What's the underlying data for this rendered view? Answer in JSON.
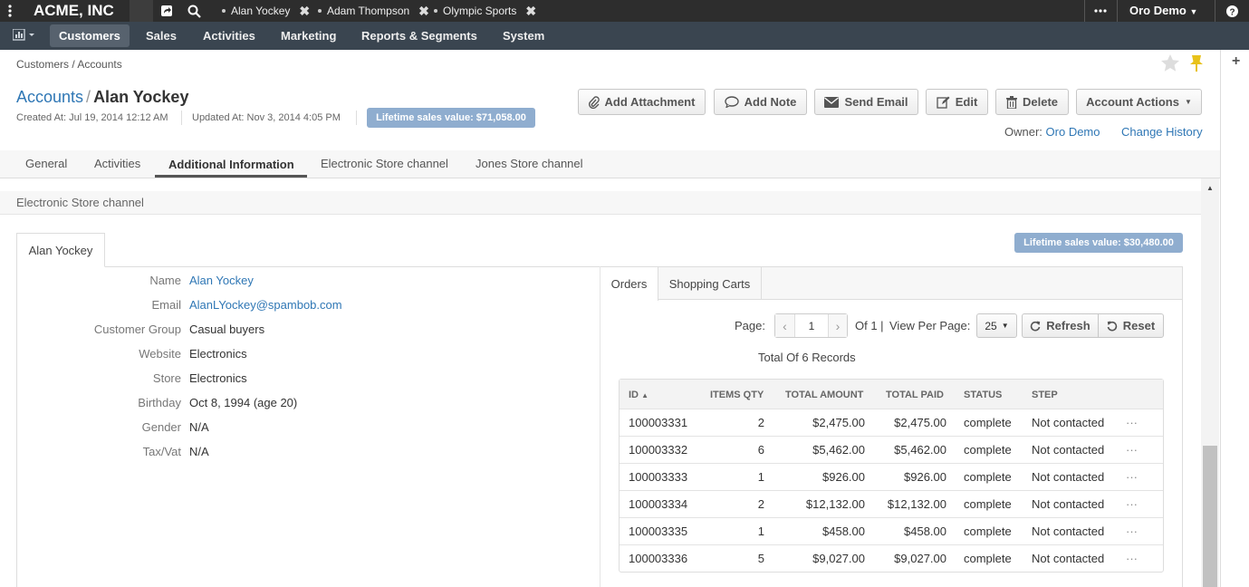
{
  "app": {
    "brand": "ACME, INC"
  },
  "pinned_tabs": [
    {
      "label": "Alan Yockey"
    },
    {
      "label": "Adam Thompson"
    },
    {
      "label": "Olympic Sports"
    }
  ],
  "user_menu": {
    "label": "Oro Demo"
  },
  "nav": {
    "items": [
      "Customers",
      "Sales",
      "Activities",
      "Marketing",
      "Reports & Segments",
      "System"
    ],
    "active": "Customers"
  },
  "breadcrumb": "Customers / Accounts",
  "page": {
    "parent": "Accounts",
    "separator": "/",
    "title": "Alan Yockey",
    "created": "Created At: Jul 19, 2014 12:12 AM",
    "updated": "Updated At: Nov 3, 2014 4:05 PM",
    "lifetime": "Lifetime sales value: $71,058.00"
  },
  "actions": {
    "add_attachment": "Add Attachment",
    "add_note": "Add Note",
    "send_email": "Send Email",
    "edit": "Edit",
    "delete": "Delete",
    "account_actions": "Account Actions"
  },
  "owner": {
    "label": "Owner:",
    "name": "Oro Demo",
    "history": "Change History"
  },
  "tabs": [
    "General",
    "Activities",
    "Additional Information",
    "Electronic Store channel",
    "Jones Store channel"
  ],
  "section": {
    "title": "Electronic Store channel"
  },
  "customer_tab": "Alan Yockey",
  "channel_lifetime": "Lifetime sales value: $30,480.00",
  "fields": [
    {
      "label": "Name",
      "value": "Alan Yockey"
    },
    {
      "label": "Email",
      "value": "AlanLYockey@spambob.com"
    },
    {
      "label": "Customer Group",
      "value": "Casual buyers"
    },
    {
      "label": "Website",
      "value": "Electronics"
    },
    {
      "label": "Store",
      "value": "Electronics"
    },
    {
      "label": "Birthday",
      "value": "Oct 8, 1994 (age 20)"
    },
    {
      "label": "Gender",
      "value": "N/A"
    },
    {
      "label": "Tax/Vat",
      "value": "N/A"
    }
  ],
  "subtabs": [
    "Orders",
    "Shopping Carts"
  ],
  "pager": {
    "page_label": "Page:",
    "page": "1",
    "of": "Of 1 |",
    "per_page_label": "View Per Page:",
    "per_page": "25",
    "refresh": "Refresh",
    "reset": "Reset",
    "total": "Total Of 6 Records"
  },
  "orders": {
    "columns": [
      "ID",
      "ITEMS QTY",
      "TOTAL AMOUNT",
      "TOTAL PAID",
      "STATUS",
      "STEP"
    ],
    "rows": [
      {
        "id": "100003331",
        "qty": "2",
        "amount": "$2,475.00",
        "paid": "$2,475.00",
        "status": "complete",
        "step": "Not contacted"
      },
      {
        "id": "100003332",
        "qty": "6",
        "amount": "$5,462.00",
        "paid": "$5,462.00",
        "status": "complete",
        "step": "Not contacted"
      },
      {
        "id": "100003333",
        "qty": "1",
        "amount": "$926.00",
        "paid": "$926.00",
        "status": "complete",
        "step": "Not contacted"
      },
      {
        "id": "100003334",
        "qty": "2",
        "amount": "$12,132.00",
        "paid": "$12,132.00",
        "status": "complete",
        "step": "Not contacted"
      },
      {
        "id": "100003335",
        "qty": "1",
        "amount": "$458.00",
        "paid": "$458.00",
        "status": "complete",
        "step": "Not contacted"
      },
      {
        "id": "100003336",
        "qty": "5",
        "amount": "$9,027.00",
        "paid": "$9,027.00",
        "status": "complete",
        "step": "Not contacted"
      }
    ],
    "row_action": "···"
  },
  "colors": {
    "topbar": "#2d2d2d",
    "navbar": "#3a4550",
    "link": "#2f77b5",
    "badge": "#8fadcf",
    "pin": "#e8c21a"
  }
}
